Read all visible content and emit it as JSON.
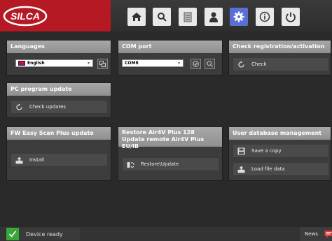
{
  "brand": {
    "logo_text": "SILCA"
  },
  "nav": [
    {
      "name": "home-icon"
    },
    {
      "name": "search-icon"
    },
    {
      "name": "document-icon"
    },
    {
      "name": "user-icon"
    },
    {
      "name": "gear-icon"
    },
    {
      "name": "info-icon"
    },
    {
      "name": "power-icon"
    }
  ],
  "panels": {
    "languages": {
      "title": "Languages",
      "selected": "English"
    },
    "com_port": {
      "title": "COM port",
      "selected": "COM8"
    },
    "registration": {
      "title": "Check registration/activation",
      "button": "Check"
    },
    "pc_update": {
      "title": "PC program update",
      "button": "Check updates"
    },
    "fw_update": {
      "title": "FW Easy Scan Plus update",
      "button": "Install"
    },
    "restore": {
      "title_line1": "Restore Air4V Plus 128",
      "title_line2": "Update remote Air4V Plus EU/IB",
      "button": "Restore\\Update"
    },
    "user_db": {
      "title": "User database management",
      "button_save": "Save a copy",
      "button_load": "Load file data"
    }
  },
  "status": {
    "ready": "Device ready",
    "news": "News"
  },
  "colors": {
    "brand_red": "#b51a24",
    "active_nav": "#5a6fd6",
    "ok_green": "#3aa63a"
  }
}
